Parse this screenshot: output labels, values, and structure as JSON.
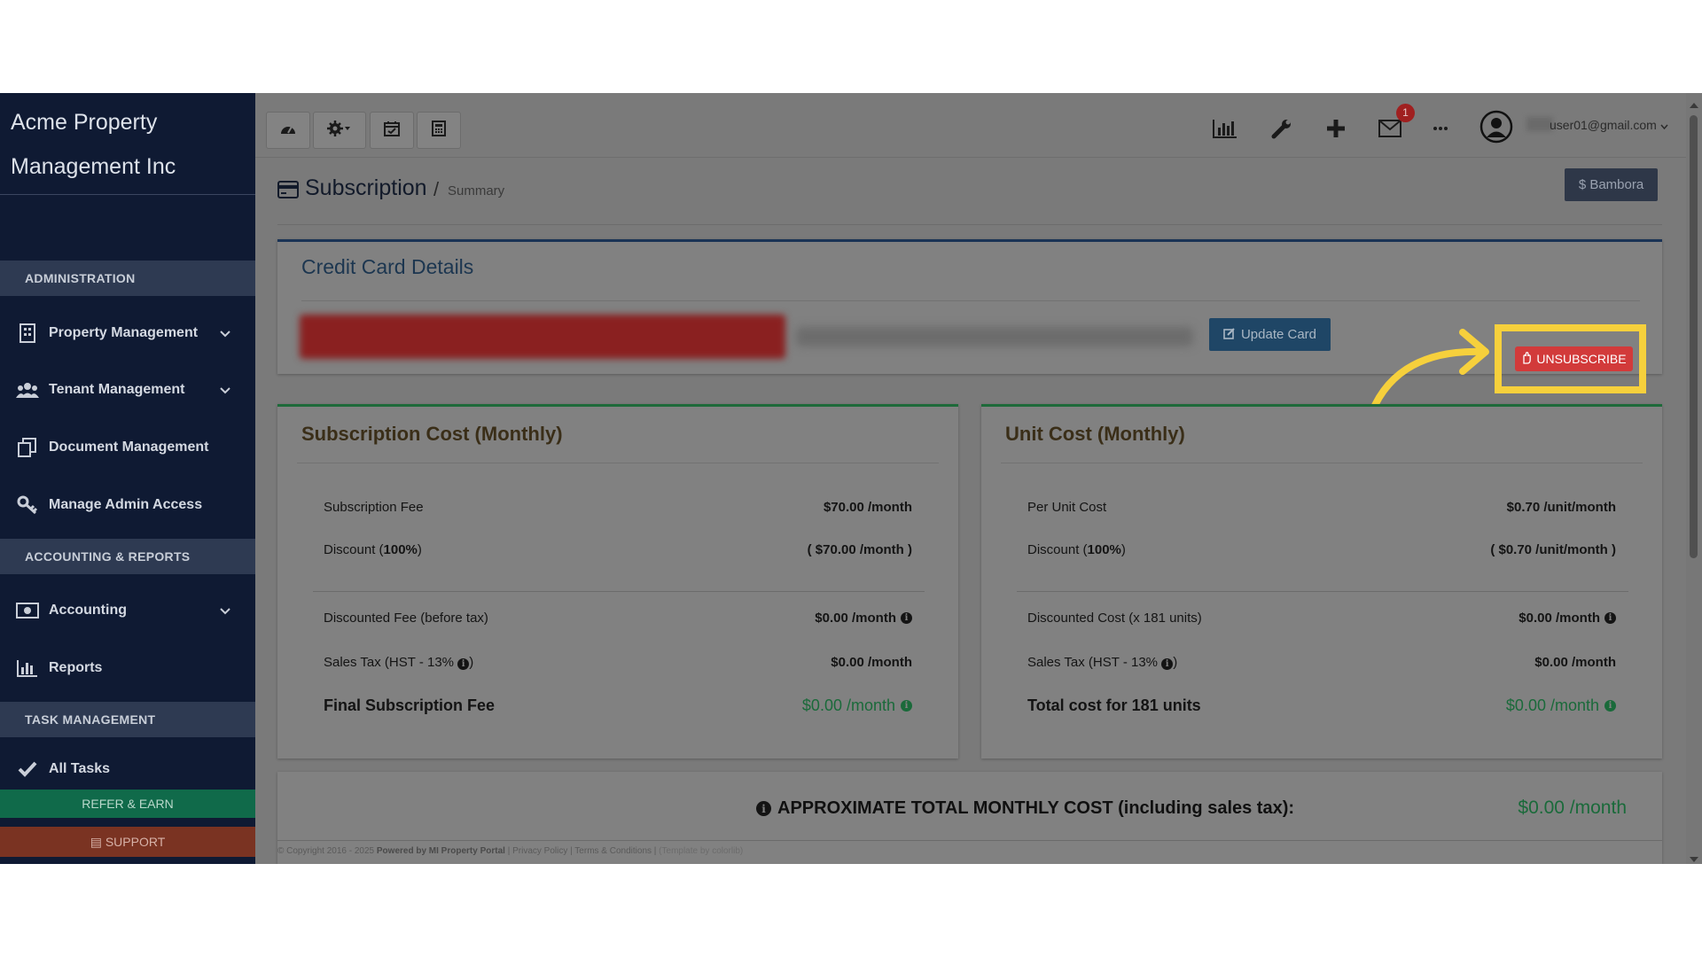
{
  "sidebar": {
    "brand": [
      "Acme Property",
      "Management Inc"
    ],
    "sections": {
      "administration": "ADMINISTRATION",
      "accounting": "ACCOUNTING & REPORTS",
      "tasks": "TASK MANAGEMENT"
    },
    "items": {
      "property": "Property Management",
      "tenant": "Tenant Management",
      "document": "Document Management",
      "admin_access": "Manage Admin Access",
      "accounting": "Accounting",
      "reports": "Reports",
      "all_tasks": "All Tasks"
    },
    "refer": "REFER & EARN",
    "support": "SUPPORT"
  },
  "topbar": {
    "notification_count": "1",
    "user_email": "user01@gmail.com"
  },
  "breadcrumb": {
    "title": "Subscription",
    "separator": "/",
    "current": "Summary"
  },
  "bambora_button": "$ Bambora",
  "credit_card": {
    "title": "Credit Card Details",
    "update_button": "Update Card",
    "unsubscribe_button": "UNSUBSCRIBE"
  },
  "subscription_cost": {
    "title": "Subscription Cost (Monthly)",
    "fee_label": "Subscription Fee",
    "fee_value": "$70.00 /month",
    "discount_label_prefix": "Discount (",
    "discount_pct": "100%",
    "discount_label_suffix": ")",
    "discount_value": "( $70.00 /month )",
    "discounted_label": "Discounted Fee (before tax)",
    "discounted_value": "$0.00 /month",
    "tax_label": "Sales Tax (HST - 13%",
    "tax_label_suffix": ")",
    "tax_value": "$0.00 /month",
    "final_label": "Final Subscription Fee",
    "final_value": "$0.00 /month"
  },
  "unit_cost": {
    "title": "Unit Cost (Monthly)",
    "per_unit_label": "Per Unit Cost",
    "per_unit_value": "$0.70 /unit/month",
    "discount_label_prefix": "Discount (",
    "discount_pct": "100%",
    "discount_label_suffix": ")",
    "discount_value": "( $0.70 /unit/month )",
    "discounted_label": "Discounted Cost (x 181 units)",
    "discounted_value": "$0.00 /month",
    "tax_label": "Sales Tax (HST - 13%",
    "tax_label_suffix": ")",
    "tax_value": "$0.00 /month",
    "total_label": "Total cost for 181 units",
    "total_value": "$0.00 /month"
  },
  "total": {
    "label": "APPROXIMATE TOTAL MONTHLY COST (including sales tax):",
    "value": "$0.00 /month"
  },
  "footer": {
    "copyright": "© Copyright 2016 - 2025",
    "powered": "Powered by MI Property Portal",
    "links": "| Privacy Policy | Terms & Conditions |",
    "template": "(Template by colorlib)"
  },
  "colors": {
    "highlight": "#f6d03c",
    "unsubscribe": "#d23a3a",
    "success": "#1a6a3a"
  }
}
